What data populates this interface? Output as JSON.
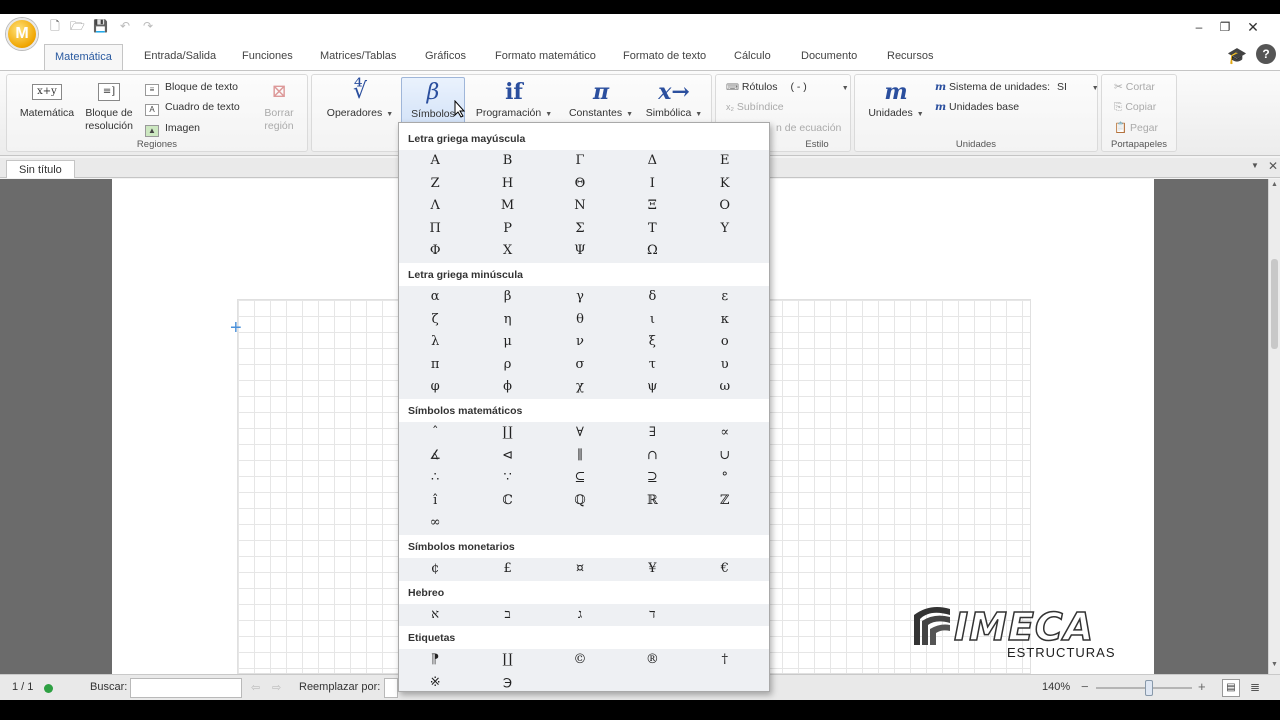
{
  "app": {
    "orb_letter": "M",
    "window_controls": [
      "–",
      "❐",
      "✕"
    ]
  },
  "tabs": [
    "Matemática",
    "Entrada/Salida",
    "Funciones",
    "Matrices/Tablas",
    "Gráficos",
    "Formato matemático",
    "Formato de texto",
    "Cálculo",
    "Documento",
    "Recursos"
  ],
  "ribbon": {
    "regiones": {
      "label": "Regiones",
      "matematica": "Matemática",
      "bloque_resolucion": "Bloque de resolución",
      "bloque_texto": "Bloque de texto",
      "cuadro_texto": "Cuadro de texto",
      "imagen": "Imagen",
      "borrar_region": "Borrar región"
    },
    "operadores": {
      "operadores": "Operadores",
      "simbolos": "Símbolos",
      "programacion": "Programación",
      "constantes": "Constantes",
      "simbolica": "Simbólica",
      "simbolos_glyph": "β",
      "programacion_glyph": "if",
      "constantes_glyph": "π",
      "simbolica_glyph": "x→"
    },
    "estilo": {
      "label": "Estilo",
      "rotulos": "Rótulos",
      "rotulos_value": "( - )",
      "subindice": "Subíndice",
      "ecuacion": "n de ecuación"
    },
    "unidades": {
      "label": "Unidades",
      "unidades": "Unidades",
      "sistema": "Sistema de unidades:",
      "sistema_value": "SI",
      "base": "Unidades base"
    },
    "portapapeles": {
      "label": "Portapapeles",
      "cortar": "Cortar",
      "copiar": "Copiar",
      "pegar": "Pegar"
    }
  },
  "document": {
    "tab": "Sin título"
  },
  "symbols_menu": {
    "sections": [
      {
        "title": "Letra griega mayúscula",
        "symbols": [
          "Α",
          "Β",
          "Γ",
          "Δ",
          "Ε",
          "Ζ",
          "Η",
          "Θ",
          "Ι",
          "Κ",
          "Λ",
          "Μ",
          "Ν",
          "Ξ",
          "Ο",
          "Π",
          "Ρ",
          "Σ",
          "Τ",
          "Υ",
          "Φ",
          "Χ",
          "Ψ",
          "Ω"
        ]
      },
      {
        "title": "Letra griega minúscula",
        "symbols": [
          "α",
          "β",
          "γ",
          "δ",
          "ε",
          "ζ",
          "η",
          "θ",
          "ι",
          "κ",
          "λ",
          "μ",
          "ν",
          "ξ",
          "ο",
          "π",
          "ρ",
          "σ",
          "τ",
          "υ",
          "φ",
          "ϕ",
          "χ",
          "ψ",
          "ω"
        ]
      },
      {
        "title": "Símbolos matemáticos",
        "symbols": [
          "ˆ",
          "∐",
          "∀",
          "∃",
          "∝",
          "∡",
          "⊲",
          "∥",
          "∩",
          "∪",
          "∴",
          "∵",
          "⊆",
          "⊇",
          "°",
          "î",
          "ℂ",
          "ℚ",
          "ℝ",
          "ℤ",
          "∞"
        ]
      },
      {
        "title": "Símbolos monetarios",
        "symbols": [
          "¢",
          "£",
          "¤",
          "¥",
          "€"
        ]
      },
      {
        "title": "Hebreo",
        "symbols": [
          "א",
          "ב",
          "ג",
          "ד"
        ]
      },
      {
        "title": "Etiquetas",
        "symbols": [
          "⁋",
          "∐",
          "©",
          "®",
          "†",
          "※",
          "℈"
        ]
      }
    ]
  },
  "statusbar": {
    "page": "1 / 1",
    "buscar": "Buscar:",
    "reemplazar": "Reemplazar por:",
    "zoom": "140%",
    "zoom_level": 0.55
  },
  "watermark": {
    "name": "IMECA",
    "sub": "ESTRUCTURAS"
  },
  "colors": {
    "accent": "#2b4f9e",
    "status_ok": "#2ea043",
    "orb": "#f0a500"
  }
}
